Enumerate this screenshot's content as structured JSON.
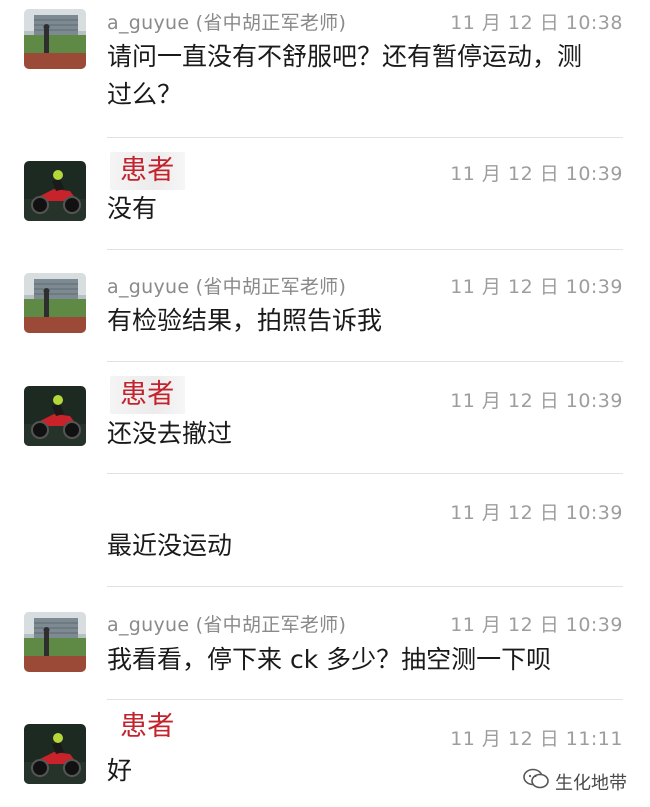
{
  "messages": [
    {
      "sender": "a_guyue (省中胡正军老师)",
      "role": "doctor",
      "time": "11 月 12 日 10:38",
      "text_lines": [
        "请问一直没有不舒服吧？还有暂停运动，测",
        "过么？"
      ]
    },
    {
      "sender": "患者",
      "role": "patient",
      "time": "11 月 12 日 10:39",
      "text_lines": [
        "没有"
      ]
    },
    {
      "sender": "a_guyue (省中胡正军老师)",
      "role": "doctor",
      "time": "11 月 12 日 10:39",
      "text_lines": [
        "有检验结果，拍照告诉我"
      ]
    },
    {
      "sender": "患者",
      "role": "patient",
      "time": "11 月 12 日 10:39",
      "text_lines": [
        "还没去撤过"
      ]
    },
    {
      "sender": "",
      "role": "patient-continued",
      "time": "11 月 12 日 10:39",
      "text_lines": [
        "最近没运动"
      ]
    },
    {
      "sender": "a_guyue (省中胡正军老师)",
      "role": "doctor",
      "time": "11 月 12 日 10:39",
      "text_lines": [
        "我看看，停下来 ck 多少？抽空测一下呗"
      ]
    },
    {
      "sender": "患者",
      "role": "patient",
      "time": "11 月 12 日 11:11",
      "text_lines": [
        "好"
      ]
    }
  ],
  "watermark": {
    "text": "生化地带",
    "icon": "wechat-official-account-icon"
  },
  "icons": {
    "doctor_avatar": "doctor-avatar-icon",
    "patient_avatar": "patient-motorcycle-avatar-icon"
  },
  "colors": {
    "patient_label": "#c3232d",
    "meta_text": "#8a8a8a",
    "body_text": "#1a1a1a",
    "divider": "#e2e2e2"
  }
}
